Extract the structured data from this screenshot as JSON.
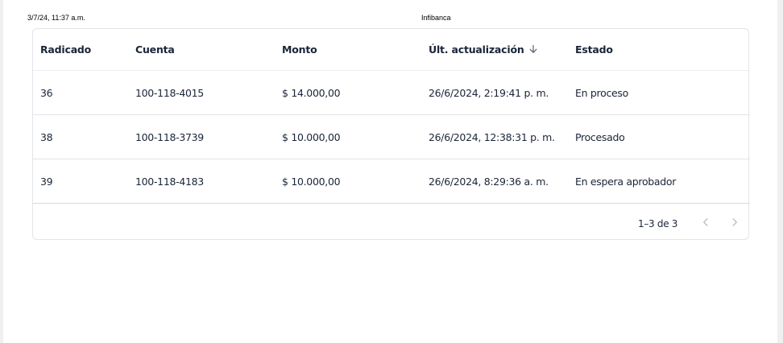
{
  "print_header": {
    "date": "3/7/24, 11:37 a.m.",
    "title": "Infibanca"
  },
  "table": {
    "columns": [
      "Radicado",
      "Cuenta",
      "Monto",
      "Últ. actualización",
      "Estado"
    ],
    "sort": {
      "column": "Últ. actualización",
      "direction": "descending",
      "icon": "arrow-down-icon"
    },
    "rows": [
      {
        "radicado": "36",
        "cuenta": "100-118-4015",
        "monto": "$ 14.000,00",
        "actualizacion": "26/6/2024, 2:19:41 p. m.",
        "estado": "En proceso"
      },
      {
        "radicado": "38",
        "cuenta": "100-118-3739",
        "monto": "$ 10.000,00",
        "actualizacion": "26/6/2024, 12:38:31 p. m.",
        "estado": "Procesado"
      },
      {
        "radicado": "39",
        "cuenta": "100-118-4183",
        "monto": "$ 10.000,00",
        "actualizacion": "26/6/2024, 8:29:36 a. m.",
        "estado": "En espera aprobador"
      }
    ]
  },
  "pagination": {
    "info": "1–3 de 3",
    "prev_icon": "chevron-left-icon",
    "next_icon": "chevron-right-icon"
  },
  "colors": {
    "text": "#1a2538",
    "border": "#e2e4e8",
    "pager_disabled": "#b9bec6"
  }
}
